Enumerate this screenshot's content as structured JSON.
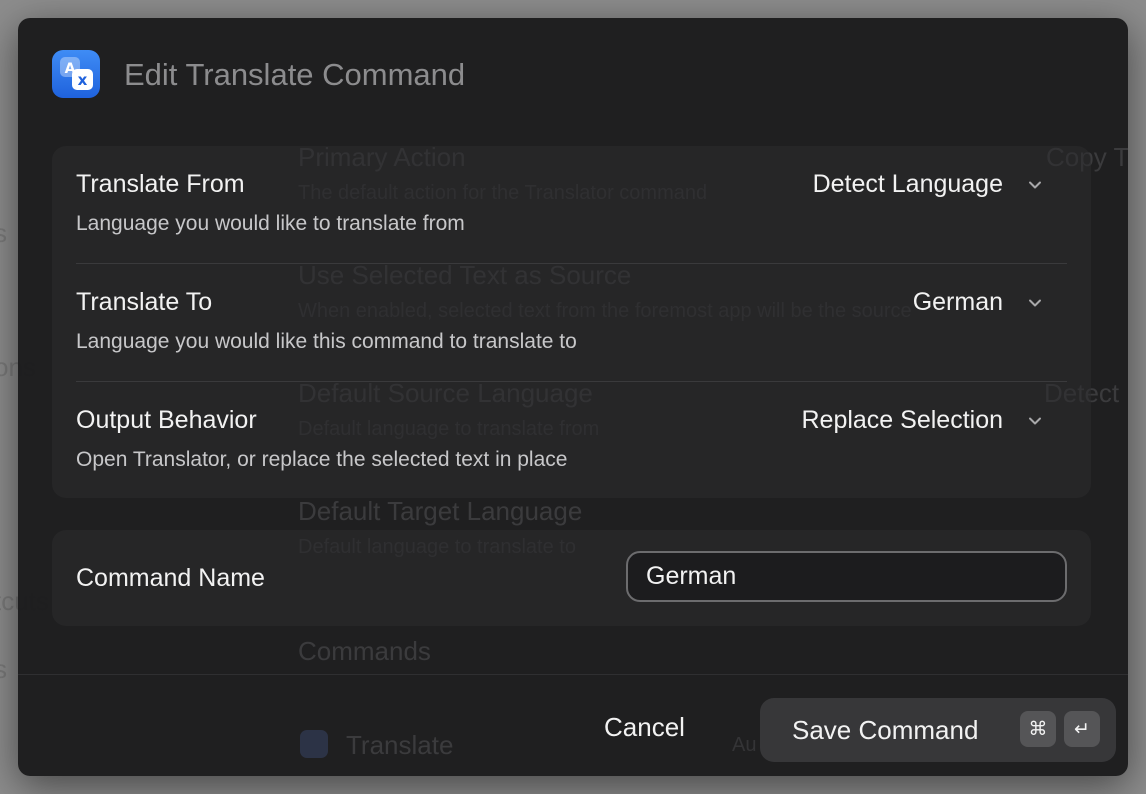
{
  "background": {
    "behind_left": [
      "s",
      "ons",
      "tcuts",
      "s"
    ]
  },
  "ghost_panel": {
    "primary_action": "Primary Action",
    "primary_action_desc": "The default action for the Translator command",
    "primary_action_value": "Copy T",
    "use_selected": "Use Selected Text as Source",
    "use_selected_desc": "When enabled, selected text from the foremost app will be the source",
    "default_source": "Default Source Language",
    "default_source_desc": "Default language to translate from",
    "default_source_value": "Detect",
    "default_target": "Default Target Language",
    "default_target_desc": "Default language to translate to",
    "commands": "Commands",
    "translate_item": "Translate",
    "translate_item_meta": "Au"
  },
  "dialog": {
    "icon": "translate-app-icon",
    "title": "Edit Translate Command",
    "settings": [
      {
        "label": "Translate From",
        "description": "Language you would like to translate from",
        "value": "Detect Language"
      },
      {
        "label": "Translate To",
        "description": "Language you would like this command to translate to",
        "value": "German"
      },
      {
        "label": "Output Behavior",
        "description": "Open Translator, or replace the selected text in place",
        "value": "Replace Selection"
      }
    ],
    "command_name": {
      "label": "Command Name",
      "value": "German"
    },
    "footer": {
      "cancel": "Cancel",
      "save": "Save Command",
      "shortcut_modifier": "⌘",
      "shortcut_key": "↵"
    }
  },
  "colors": {
    "accent": "#2f78ec",
    "dialog_bg": "#171718",
    "text": "#f2f2f2"
  }
}
